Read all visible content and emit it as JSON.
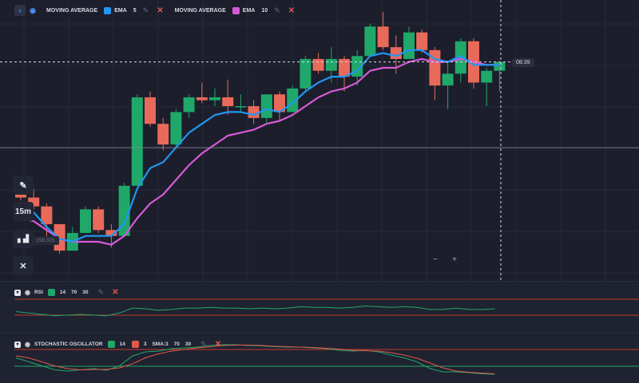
{
  "toolbar": {
    "indicators": [
      {
        "name": "MOVING AVERAGE",
        "type": "EMA",
        "period": "5",
        "color": "#2196f3"
      },
      {
        "name": "MOVING AVERAGE",
        "type": "EMA",
        "period": "10",
        "color": "#d65ad6"
      }
    ]
  },
  "side_tools": {
    "pencil_icon": "pencil-icon",
    "timeframe": "15m",
    "chart_type_icon": "bar-chart-icon",
    "tools_icon": "tools-icon"
  },
  "main_chart": {
    "current_price_label": "08:39",
    "y_readout": "156.325",
    "zoom_out": "−",
    "zoom_in": "+"
  },
  "rsi_panel": {
    "name": "RSI",
    "period": "14",
    "upper": "70",
    "lower": "30",
    "color": "#1fa86a"
  },
  "stoch_panel": {
    "name": "STOCHASTIC OSCILLATOR",
    "k_period": "14",
    "k_color": "#1fa86a",
    "d_period": "3",
    "d_color": "#e0594d",
    "sma": "SMA:3",
    "upper": "70",
    "lower": "30"
  },
  "colors": {
    "up": "#1fa86a",
    "down": "#e86a5a",
    "ema5": "#2196f3",
    "ema10": "#d65ad6",
    "background": "#1c1e2b"
  },
  "chart_data": {
    "type": "candlestick",
    "candles": [
      {
        "o": 6,
        "h": 9,
        "l": 4,
        "c": 5
      },
      {
        "o": 5,
        "h": 8,
        "l": 1,
        "c": 2
      },
      {
        "o": 2,
        "h": 3,
        "l": -9,
        "c": -4
      },
      {
        "o": -4,
        "h": -4,
        "l": -14,
        "c": -13
      },
      {
        "o": -13,
        "h": -5,
        "l": -13,
        "c": -7
      },
      {
        "o": -7,
        "h": 2,
        "l": -7,
        "c": 1
      },
      {
        "o": 1,
        "h": 2,
        "l": -7,
        "c": -6
      },
      {
        "o": -6,
        "h": -4,
        "l": -12,
        "c": -8
      },
      {
        "o": -8,
        "h": 10,
        "l": -8,
        "c": 9
      },
      {
        "o": 9,
        "h": 40,
        "l": 9,
        "c": 39
      },
      {
        "o": 39,
        "h": 41,
        "l": 29,
        "c": 30
      },
      {
        "o": 30,
        "h": 32,
        "l": 21,
        "c": 23
      },
      {
        "o": 23,
        "h": 35,
        "l": 22,
        "c": 34
      },
      {
        "o": 34,
        "h": 40,
        "l": 32,
        "c": 39
      },
      {
        "o": 39,
        "h": 44,
        "l": 37,
        "c": 38
      },
      {
        "o": 38,
        "h": 42,
        "l": 36,
        "c": 39
      },
      {
        "o": 39,
        "h": 45,
        "l": 33,
        "c": 36
      },
      {
        "o": 36,
        "h": 40,
        "l": 34,
        "c": 36
      },
      {
        "o": 36,
        "h": 38,
        "l": 30,
        "c": 32
      },
      {
        "o": 32,
        "h": 40,
        "l": 30,
        "c": 40
      },
      {
        "o": 40,
        "h": 41,
        "l": 31,
        "c": 34
      },
      {
        "o": 34,
        "h": 43,
        "l": 34,
        "c": 42
      },
      {
        "o": 42,
        "h": 53,
        "l": 41,
        "c": 52
      },
      {
        "o": 52,
        "h": 54,
        "l": 47,
        "c": 48
      },
      {
        "o": 48,
        "h": 56,
        "l": 44,
        "c": 52
      },
      {
        "o": 52,
        "h": 53,
        "l": 41,
        "c": 46
      },
      {
        "o": 46,
        "h": 55,
        "l": 43,
        "c": 53
      },
      {
        "o": 53,
        "h": 64,
        "l": 53,
        "c": 63
      },
      {
        "o": 63,
        "h": 68,
        "l": 55,
        "c": 56
      },
      {
        "o": 56,
        "h": 60,
        "l": 47,
        "c": 52
      },
      {
        "o": 52,
        "h": 63,
        "l": 52,
        "c": 61
      },
      {
        "o": 61,
        "h": 62,
        "l": 54,
        "c": 55
      },
      {
        "o": 55,
        "h": 56,
        "l": 38,
        "c": 43
      },
      {
        "o": 43,
        "h": 51,
        "l": 35,
        "c": 47
      },
      {
        "o": 47,
        "h": 59,
        "l": 44,
        "c": 58
      },
      {
        "o": 58,
        "h": 59,
        "l": 42,
        "c": 44
      },
      {
        "o": 44,
        "h": 49,
        "l": 36,
        "c": 48
      },
      {
        "o": 48,
        "h": 51,
        "l": 41,
        "c": 51
      }
    ],
    "ema5": [
      2,
      0,
      -5,
      -9,
      -10,
      -8,
      -8,
      -8,
      -4,
      8,
      15,
      17,
      22,
      27,
      30,
      33,
      34,
      34,
      33,
      35,
      34,
      37,
      41,
      44,
      46,
      46,
      48,
      53,
      54,
      53,
      55,
      55,
      52,
      51,
      53,
      50,
      50,
      50
    ],
    "ema10": [
      -2,
      -3,
      -6,
      -9,
      -10,
      -10,
      -10,
      -11,
      -8,
      -2,
      3,
      6,
      11,
      16,
      20,
      23,
      26,
      27,
      28,
      30,
      31,
      33,
      36,
      39,
      41,
      42,
      44,
      48,
      49,
      49,
      51,
      52,
      51,
      51,
      52,
      51,
      50,
      50
    ],
    "rsi": [
      50,
      48,
      46,
      44,
      45,
      46,
      45,
      44,
      48,
      55,
      54,
      52,
      53,
      55,
      55,
      56,
      55,
      55,
      54,
      55,
      54,
      55,
      57,
      56,
      56,
      55,
      56,
      58,
      57,
      56,
      57,
      56,
      53,
      53,
      55,
      53,
      53,
      54
    ],
    "stoch_k": [
      55,
      45,
      35,
      25,
      22,
      25,
      28,
      24,
      35,
      60,
      70,
      72,
      78,
      80,
      82,
      86,
      88,
      88,
      86,
      85,
      83,
      82,
      82,
      80,
      78,
      74,
      72,
      74,
      70,
      62,
      55,
      45,
      28,
      20,
      20,
      18,
      15,
      14
    ],
    "stoch_d": [
      60,
      55,
      45,
      35,
      28,
      25,
      26,
      26,
      30,
      40,
      55,
      65,
      72,
      76,
      80,
      83,
      86,
      87,
      87,
      86,
      84,
      83,
      82,
      81,
      79,
      77,
      74,
      73,
      72,
      68,
      62,
      54,
      42,
      30,
      22,
      19,
      17,
      15
    ]
  }
}
